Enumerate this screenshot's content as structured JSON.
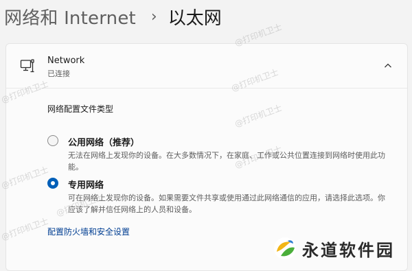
{
  "breadcrumb": {
    "parent": "网络和 Internet",
    "separator": "›",
    "current": "以太网"
  },
  "network": {
    "name": "Network",
    "status": "已连接",
    "icon": "ethernet-pc-icon",
    "expand_icon": "chevron-up-icon"
  },
  "profile": {
    "title": "网络配置文件类型",
    "options": [
      {
        "label": "公用网络（推荐）",
        "description": "无法在网络上发现你的设备。在大多数情况下，在家庭、工作或公共位置连接到网络时使用此功能。",
        "selected": false
      },
      {
        "label": "专用网络",
        "description": "可在网络上发现你的设备。如果需要文件共享或使用通过此网络通信的应用，请选择此选项。你应该了解并信任网络上的人员和设备。",
        "selected": true
      }
    ],
    "link": "配置防火墙和安全设置"
  },
  "watermark": "@打印机卫士",
  "logo": {
    "text": "永道软件园"
  },
  "colors": {
    "accent": "#005fb8",
    "link": "#003e92"
  }
}
